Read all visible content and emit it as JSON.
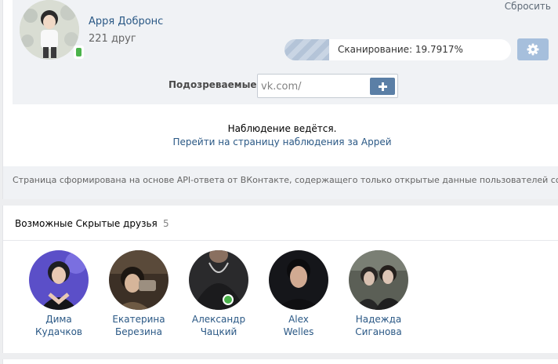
{
  "header": {
    "reset_label": "Сбросить"
  },
  "profile": {
    "name": "Арря Добронс",
    "friends_count": "221 друг",
    "mobile_badge_icon": "mobile-phone-icon"
  },
  "scan": {
    "progress_fraction": 0.197917,
    "label": "Сканирование: 19.7917%",
    "settings_icon": "gear-icon"
  },
  "suspects": {
    "label": "Подозреваемые:",
    "input_value": "vk.com/",
    "add_icon": "plus-icon"
  },
  "watch": {
    "status": "Наблюдение ведётся.",
    "link": "Перейти на страницу наблюдения за Аррей"
  },
  "footnote": "Страница сформирована на основе API-ответа от ВКонтакте, содержащего только открытые данные пользователей социальной сети.",
  "hidden_friends": {
    "title": "Возможные Скрытые друзья",
    "count": "5",
    "friends": [
      {
        "name_line1": "Дима",
        "name_line2": "Кудачков",
        "online": false
      },
      {
        "name_line1": "Екатерина",
        "name_line2": "Березина",
        "online": false
      },
      {
        "name_line1": "Александр",
        "name_line2": "Чацкий",
        "online": true
      },
      {
        "name_line1": "Alex",
        "name_line2": "Welles",
        "online": false
      },
      {
        "name_line1": "Надежда",
        "name_line2": "Сиганова",
        "online": false
      }
    ]
  },
  "colors": {
    "link": "#2a5885",
    "accent_button": "#5b7fa6",
    "online": "#4bb34b",
    "panel_bg": "#f0f2f5"
  }
}
